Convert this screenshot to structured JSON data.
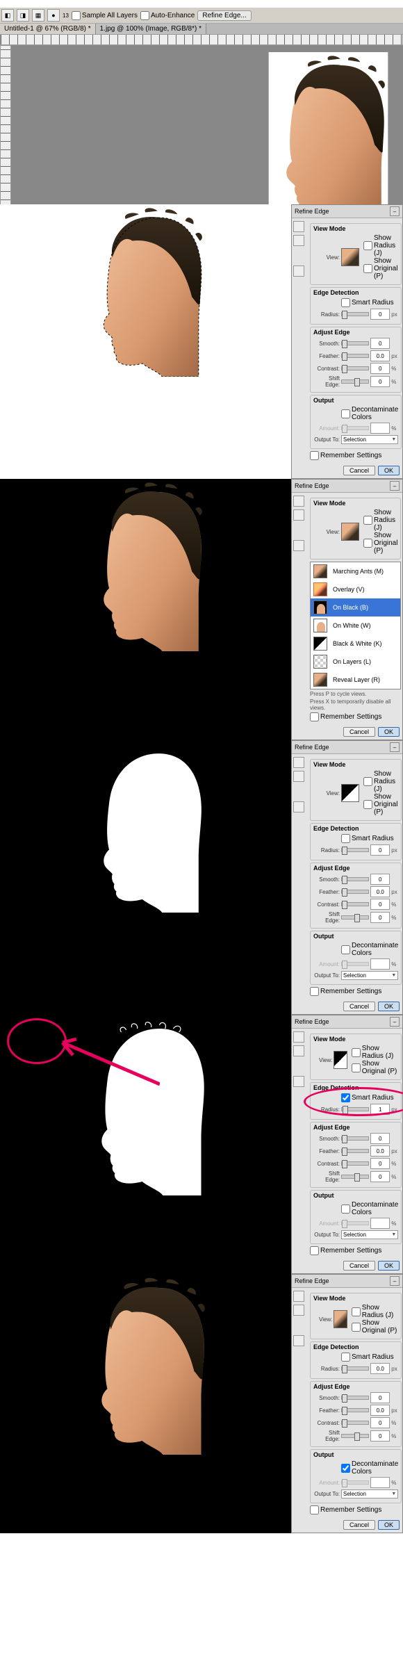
{
  "toolbar": {
    "sample_all": "Sample All Layers",
    "auto_enhance": "Auto-Enhance",
    "refine_edge": "Refine Edge..."
  },
  "tabs": {
    "tab1": "Untitled-1 @ 67% (RGB/8) *",
    "tab2": "1.jpg @ 100% (Image, RGB/8*) *"
  },
  "panel": {
    "title": "Refine Edge",
    "view_mode": "View Mode",
    "view": "View:",
    "show_radius": "Show Radius (J)",
    "show_original": "Show Original (P)",
    "edge_detection": "Edge Detection",
    "smart_radius": "Smart Radius",
    "radius": "Radius:",
    "adjust_edge": "Adjust Edge",
    "smooth": "Smooth:",
    "feather": "Feather:",
    "contrast": "Contrast:",
    "shift_edge": "Shift Edge:",
    "output": "Output",
    "decontaminate": "Decontaminate Colors",
    "amount": "Amount:",
    "output_to": "Output To:",
    "output_sel": "Selection",
    "remember": "Remember Settings",
    "cancel": "Cancel",
    "ok": "OK",
    "hint1": "Press P to cycle views.",
    "hint2": "Press X to temporarily disable all views."
  },
  "menu": {
    "marching": "Marching Ants (M)",
    "overlay": "Overlay (V)",
    "on_black": "On Black (B)",
    "on_white": "On White (W)",
    "bw": "Black & White (K)",
    "on_layers": "On Layers (L)",
    "reveal": "Reveal Layer (R)"
  },
  "vals": {
    "a": {
      "radius": "0",
      "smooth": "0",
      "feather": "0.0",
      "contrast": "0",
      "shift": "0"
    },
    "b": {
      "radius": "0",
      "smooth": "0",
      "feather": "0.0",
      "contrast": "0",
      "shift": "0"
    },
    "c": {
      "radius": "1",
      "smooth": "0",
      "feather": "0.0",
      "contrast": "0",
      "shift": "0"
    },
    "d": {
      "radius": "0.0",
      "smooth": "0",
      "feather": "0.0",
      "contrast": "0",
      "shift": "0"
    }
  },
  "units": {
    "px": "px",
    "pct": "%"
  }
}
